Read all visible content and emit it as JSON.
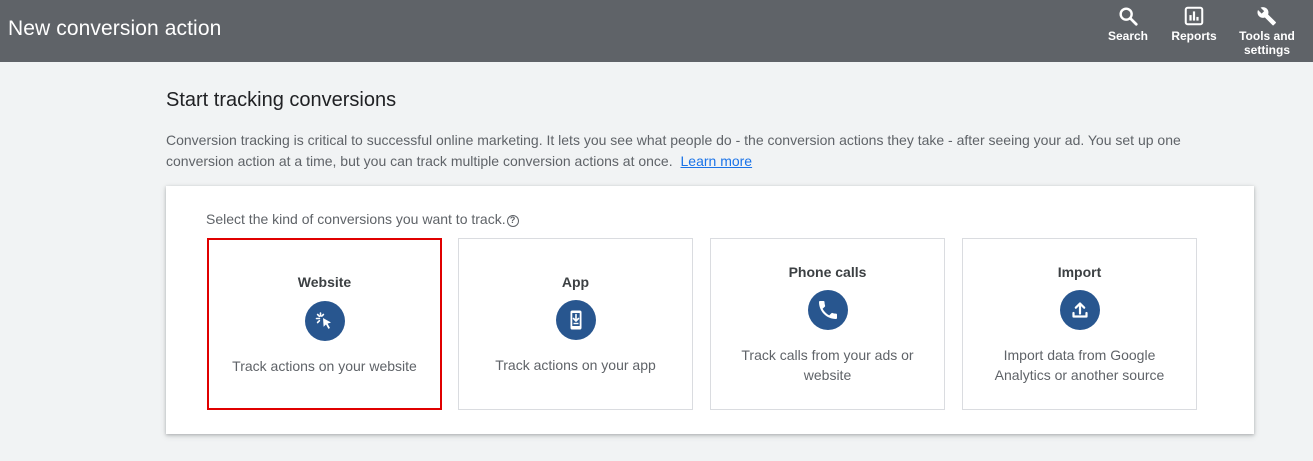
{
  "header": {
    "title": "New conversion action",
    "tools": [
      {
        "label": "Search",
        "icon": "search-icon"
      },
      {
        "label": "Reports",
        "icon": "reports-icon"
      },
      {
        "label": "Tools and settings",
        "icon": "wrench-icon"
      }
    ]
  },
  "main": {
    "heading": "Start tracking conversions",
    "description": "Conversion tracking is critical to successful online marketing. It lets you see what people do - the conversion actions they take - after seeing your ad. You set up one conversion action at a time, but you can track multiple conversion actions at once.",
    "learn_more": "Learn more",
    "prompt": "Select the kind of conversions you want to track.",
    "help_glyph": "?",
    "options": [
      {
        "title": "Website",
        "icon": "cursor-click-icon",
        "description": "Track actions on your website",
        "selected": true
      },
      {
        "title": "App",
        "icon": "phone-download-icon",
        "description": "Track actions on your app",
        "selected": false
      },
      {
        "title": "Phone calls",
        "icon": "phone-call-icon",
        "description": "Track calls from your ads or website",
        "selected": false
      },
      {
        "title": "Import",
        "icon": "upload-icon",
        "description": "Import data from Google Analytics or another source",
        "selected": false
      }
    ]
  },
  "colors": {
    "header_bg": "#5f6368",
    "icon_circle": "#28568f",
    "selected_border": "#e00000",
    "link": "#1a73e8"
  }
}
